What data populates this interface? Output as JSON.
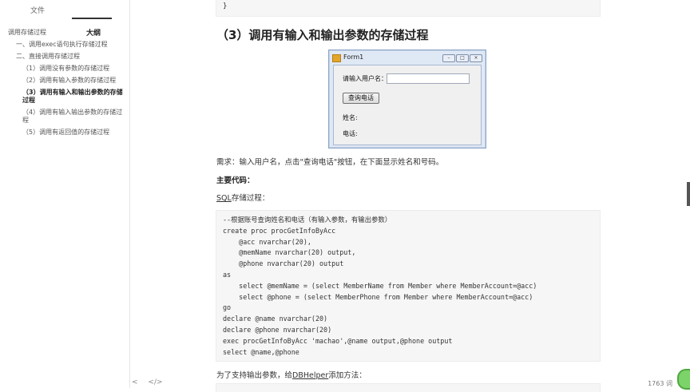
{
  "sidebar": {
    "tabs": {
      "files": "文件",
      "outline": "大纲"
    },
    "outline_items": [
      "调用存储过程",
      "一、调用exec语句执行存储过程",
      "二、直接调用存储过程",
      "（1）调用没有参数的存储过程",
      "（2）调用有输入参数的存储过程",
      "（3）调用有输入和输出参数的存储过程",
      "（4）调用有输入输出参数的存储过程",
      "（5）调用有返回值的存储过程"
    ]
  },
  "bottom_bar": {
    "collapse": "<",
    "code": "</>"
  },
  "doc": {
    "top_code_brace": "}",
    "section_heading": "（3）调用有输入和输出参数的存储过程",
    "form": {
      "title": "Form1",
      "username_label": "请输入用户名：",
      "query_button": "查询电话",
      "name_label": "姓名:",
      "phone_label": "电话:"
    },
    "requirement": "需求：输入用户名，点击\"查询电话\"按钮，在下面显示姓名和号码。",
    "main_code_label": "主要代码：",
    "sql_label_link": "SQL",
    "sql_label_rest": "存储过程：",
    "code": "--根据账号查询姓名和电话（有输入参数，有输出参数）\ncreate proc procGetInfoByAcc\n    @acc nvarchar(20),\n    @memName nvarchar(20) output,\n    @phone nvarchar(20) output\nas\n    select @memName = (select MemberName from Member where MemberAccount=@acc)\n    select @phone = (select MemberPhone from Member where MemberAccount=@acc)\ngo\ndeclare @name nvarchar(20)\ndeclare @phone nvarchar(20)\nexec procGetInfoByAcc 'machao',@name output,@phone output\nselect @name,@phone",
    "helper_pre": "为了支持输出参数，给",
    "helper_link": "DBHelper",
    "helper_post": "添加方法："
  },
  "status": {
    "word_count": "1763 词"
  },
  "badge": {
    "text": ""
  }
}
